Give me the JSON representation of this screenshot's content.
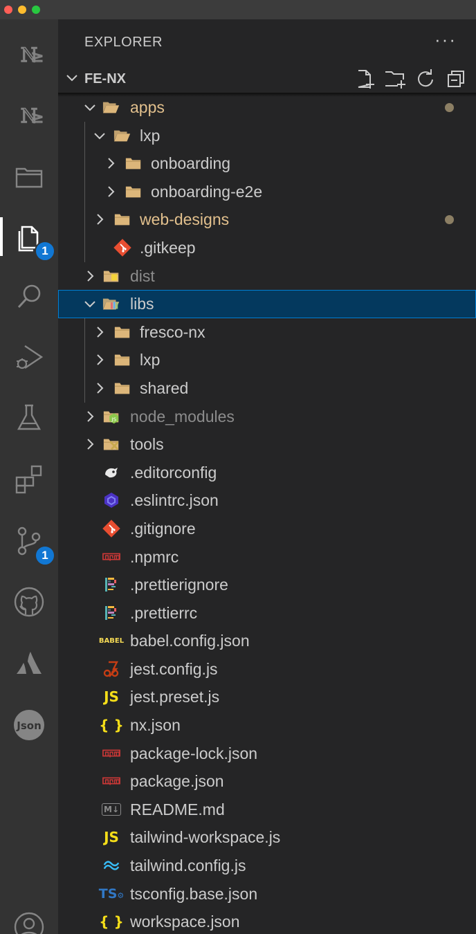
{
  "window": {
    "traffic_colors": [
      "#ff5f57",
      "#febc2e",
      "#28c840"
    ]
  },
  "activity_bar": {
    "items": [
      {
        "name": "nx-console-icon",
        "glyph": "NX"
      },
      {
        "name": "nx-projects-icon",
        "glyph": "NX"
      },
      {
        "name": "folders-icon"
      },
      {
        "name": "explorer-icon",
        "badge": "1",
        "active": true
      },
      {
        "name": "search-icon"
      },
      {
        "name": "run-debug-icon"
      },
      {
        "name": "testing-icon"
      },
      {
        "name": "extensions-icon"
      },
      {
        "name": "source-control-icon",
        "badge": "1"
      },
      {
        "name": "github-icon"
      },
      {
        "name": "atlassian-icon"
      },
      {
        "name": "json-icon",
        "glyph": "Json"
      },
      {
        "name": "accounts-icon"
      }
    ]
  },
  "explorer": {
    "title": "EXPLORER",
    "more_label": "···",
    "section": {
      "label": "FE-NX",
      "actions": [
        "new-file-icon",
        "new-folder-icon",
        "refresh-icon",
        "collapse-all-icon"
      ]
    },
    "tree": [
      {
        "label": "apps",
        "depth": 1,
        "type": "folder",
        "expanded": true,
        "status": "modified",
        "dot": true
      },
      {
        "label": "lxp",
        "depth": 2,
        "type": "folder",
        "expanded": true
      },
      {
        "label": "onboarding",
        "depth": 3,
        "type": "folder",
        "expanded": false
      },
      {
        "label": "onboarding-e2e",
        "depth": 3,
        "type": "folder",
        "expanded": false
      },
      {
        "label": "web-designs",
        "depth": 2,
        "type": "folder",
        "expanded": false,
        "status": "modified",
        "dot": true
      },
      {
        "label": ".gitkeep",
        "depth": 2,
        "type": "file",
        "icon": "git"
      },
      {
        "label": "dist",
        "depth": 1,
        "type": "folder",
        "expanded": false,
        "status": "ignored",
        "icon": "dist"
      },
      {
        "label": "libs",
        "depth": 1,
        "type": "folder",
        "expanded": true,
        "selected": true,
        "icon": "libs"
      },
      {
        "label": "fresco-nx",
        "depth": 2,
        "type": "folder",
        "expanded": false
      },
      {
        "label": "lxp",
        "depth": 2,
        "type": "folder",
        "expanded": false
      },
      {
        "label": "shared",
        "depth": 2,
        "type": "folder",
        "expanded": false
      },
      {
        "label": "node_modules",
        "depth": 1,
        "type": "folder",
        "expanded": false,
        "status": "ignored",
        "icon": "node"
      },
      {
        "label": "tools",
        "depth": 1,
        "type": "folder",
        "expanded": false,
        "icon": "tools"
      },
      {
        "label": ".editorconfig",
        "depth": 1,
        "type": "file",
        "icon": "editorconfig"
      },
      {
        "label": ".eslintrc.json",
        "depth": 1,
        "type": "file",
        "icon": "eslint"
      },
      {
        "label": ".gitignore",
        "depth": 1,
        "type": "file",
        "icon": "git"
      },
      {
        "label": ".npmrc",
        "depth": 1,
        "type": "file",
        "icon": "npm"
      },
      {
        "label": ".prettierignore",
        "depth": 1,
        "type": "file",
        "icon": "prettier"
      },
      {
        "label": ".prettierrc",
        "depth": 1,
        "type": "file",
        "icon": "prettier"
      },
      {
        "label": "babel.config.json",
        "depth": 1,
        "type": "file",
        "icon": "babel",
        "icon_text": "BABEL"
      },
      {
        "label": "jest.config.js",
        "depth": 1,
        "type": "file",
        "icon": "jest"
      },
      {
        "label": "jest.preset.js",
        "depth": 1,
        "type": "file",
        "icon": "js",
        "icon_text": "JS"
      },
      {
        "label": "nx.json",
        "depth": 1,
        "type": "file",
        "icon": "json",
        "icon_text": "{ }"
      },
      {
        "label": "package-lock.json",
        "depth": 1,
        "type": "file",
        "icon": "npm"
      },
      {
        "label": "package.json",
        "depth": 1,
        "type": "file",
        "icon": "npm"
      },
      {
        "label": "README.md",
        "depth": 1,
        "type": "file",
        "icon": "markdown",
        "icon_text": "M↓"
      },
      {
        "label": "tailwind-workspace.js",
        "depth": 1,
        "type": "file",
        "icon": "js",
        "icon_text": "JS"
      },
      {
        "label": "tailwind.config.js",
        "depth": 1,
        "type": "file",
        "icon": "tailwind"
      },
      {
        "label": "tsconfig.base.json",
        "depth": 1,
        "type": "file",
        "icon": "tsconfig",
        "icon_text": "TS"
      },
      {
        "label": "workspace.json",
        "depth": 1,
        "type": "file",
        "icon": "json",
        "icon_text": "{ }"
      }
    ]
  },
  "colors": {
    "modified": "#e2c08d",
    "ignored": "#8c8c8c",
    "selection": "#04395e",
    "selection_border": "#007fd4",
    "badge": "#1177d3",
    "folder": "#dcb67a"
  }
}
